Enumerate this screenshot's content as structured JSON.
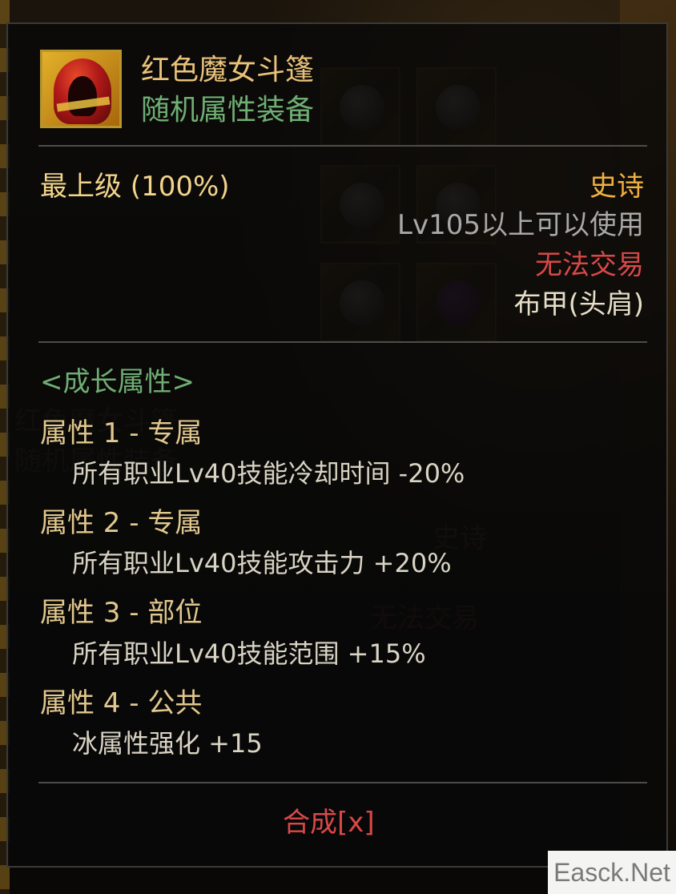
{
  "item": {
    "name": "红色魔女斗篷",
    "type": "随机属性装备",
    "icon": "red-witch-cloak-icon",
    "grade": "最上级 (100%)",
    "rarity": "史诗",
    "level_requirement": "Lv105以上可以使用",
    "trade_status": "无法交易",
    "slot": "布甲(头肩)"
  },
  "growth": {
    "header": "<成长属性>",
    "attributes": [
      {
        "title": "属性 1 - 专属",
        "desc": "所有职业Lv40技能冷却时间 -20%"
      },
      {
        "title": "属性 2 - 专属",
        "desc": "所有职业Lv40技能攻击力 +20%"
      },
      {
        "title": "属性 3 - 部位",
        "desc": "所有职业Lv40技能范围 +15%"
      },
      {
        "title": "属性 4 - 公共",
        "desc": "冰属性强化 +15"
      }
    ]
  },
  "actions": {
    "compose": "合成[x]"
  },
  "watermark": "Easck.Net",
  "colors": {
    "item_name": "#e9c27a",
    "item_type": "#6fae73",
    "rarity": "#f0b040",
    "untradeable": "#d84848",
    "attr_title": "#e2c88e"
  }
}
